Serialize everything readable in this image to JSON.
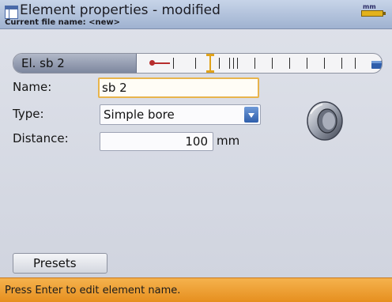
{
  "window": {
    "title": "Element properties - modified",
    "subtitle": "Current file name: <new>",
    "unit_indicator": "mm"
  },
  "element_strip": {
    "selected_element": "El. sb 2"
  },
  "form": {
    "name_label": "Name:",
    "name_value": "sb 2",
    "type_label": "Type:",
    "type_value": "Simple bore",
    "distance_label": "Distance:",
    "distance_value": "100",
    "distance_unit": "mm"
  },
  "buttons": {
    "presets_label": "Presets"
  },
  "status": {
    "message": "Press Enter to edit element name."
  },
  "colors": {
    "status_bar": "#e68f1f",
    "title_bar": "#9fb2d0",
    "focus_border": "#e8b44c",
    "coupling_marker": "#b72d2d"
  },
  "icons": [
    "window-icon",
    "battery-icon",
    "coupling-icon",
    "machine-icon",
    "dropdown-arrow-icon",
    "simple-bore-icon"
  ]
}
